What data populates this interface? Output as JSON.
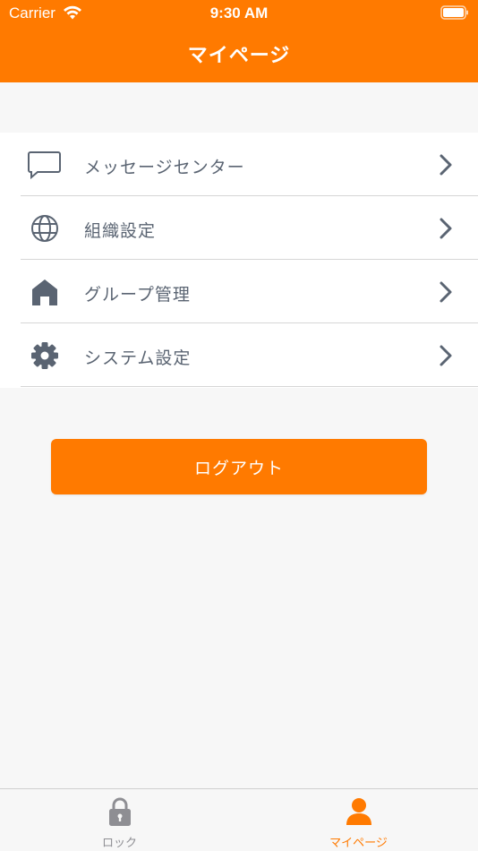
{
  "status_bar": {
    "carrier": "Carrier",
    "time": "9:30 AM"
  },
  "header": {
    "title": "マイページ"
  },
  "menu": {
    "items": [
      {
        "label": "メッセージセンター",
        "icon": "message-bubble-icon"
      },
      {
        "label": "組織設定",
        "icon": "globe-icon"
      },
      {
        "label": "グループ管理",
        "icon": "house-icon"
      },
      {
        "label": "システム設定",
        "icon": "gear-icon"
      }
    ]
  },
  "logout": {
    "label": "ログアウト"
  },
  "tab_bar": {
    "tabs": [
      {
        "label": "ロック",
        "icon": "lock-icon",
        "selected": false
      },
      {
        "label": "マイページ",
        "icon": "person-icon",
        "selected": true
      }
    ]
  },
  "colors": {
    "accent": "#ff7a00",
    "text": "#5a6472",
    "inactive_tab": "#8e8e93"
  }
}
